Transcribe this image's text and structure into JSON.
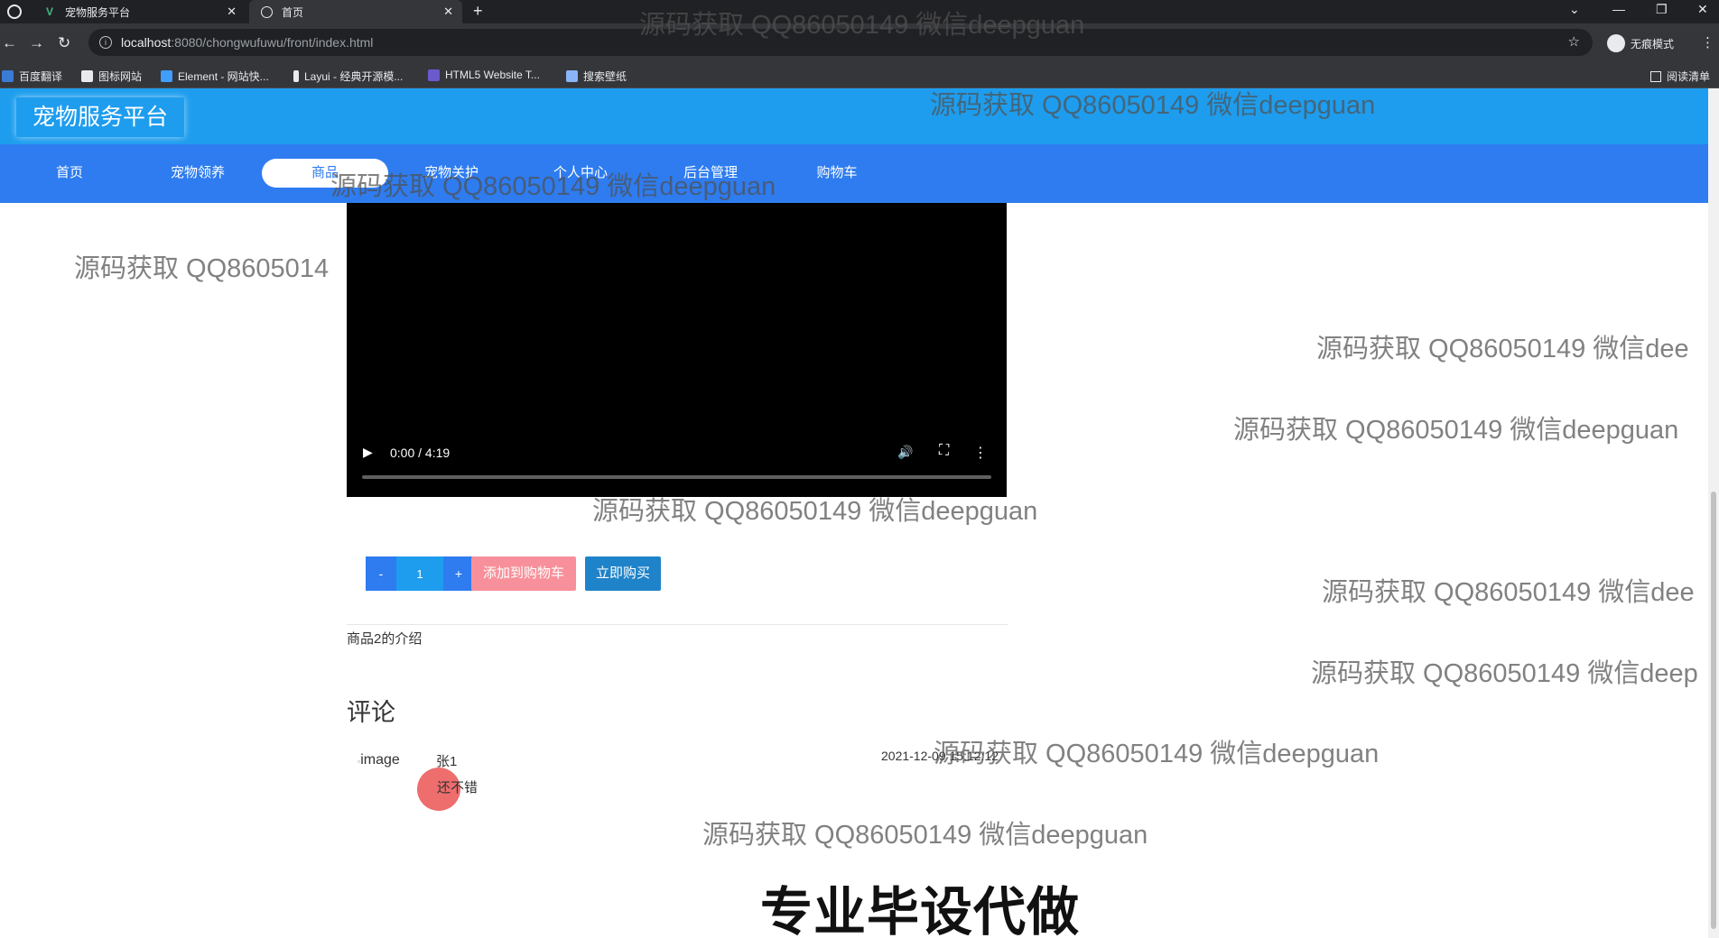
{
  "browser": {
    "tabs": [
      {
        "title": "宠物服务平台",
        "active": false
      },
      {
        "title": "首页",
        "active": true
      }
    ],
    "url_host": "localhost",
    "url_path": ":8080/chongwufuwu/front/index.html",
    "profile_label": "无痕模式",
    "bookmarks": [
      "百度翻译",
      "图标网站",
      "Element - 网站快...",
      "Layui - 经典开源模...",
      "HTML5 Website T...",
      "搜索壁纸"
    ],
    "reading_list": "阅读清单"
  },
  "site": {
    "title": "宠物服务平台",
    "nav": [
      "首页",
      "宠物领养",
      "商品",
      "宠物关护",
      "个人中心",
      "后台管理",
      "购物车"
    ],
    "active_nav": "商品",
    "nav_active_color": "#2e7cf0",
    "header_color": "#1e9dee"
  },
  "video": {
    "time": "0:00 / 4:19",
    "play_icon": "play-icon",
    "volume_icon": "volume-icon",
    "fullscreen_icon": "fullscreen-icon",
    "more_icon": "more-vert-icon",
    "progress": 0
  },
  "product": {
    "minus": "-",
    "quantity": "1",
    "plus": "+",
    "add_to_cart": "添加到购物车",
    "buy_now": "立即购买",
    "description": "商品2的介绍"
  },
  "comments": {
    "title": "评论",
    "items": [
      {
        "image_alt": "image",
        "user": "张1",
        "text": "还不错",
        "time": "2021-12-09 15:12:12"
      }
    ]
  },
  "watermark": {
    "text": "源码获取 QQ86050149 微信deepguan",
    "text_cut_1": "源码获取 QQ8605014",
    "text_cut_2": "源码获取 QQ86050149 微信dee",
    "text_cut_3": "源码获取 QQ86050149 微信deep",
    "banner": "专业毕设代做"
  }
}
